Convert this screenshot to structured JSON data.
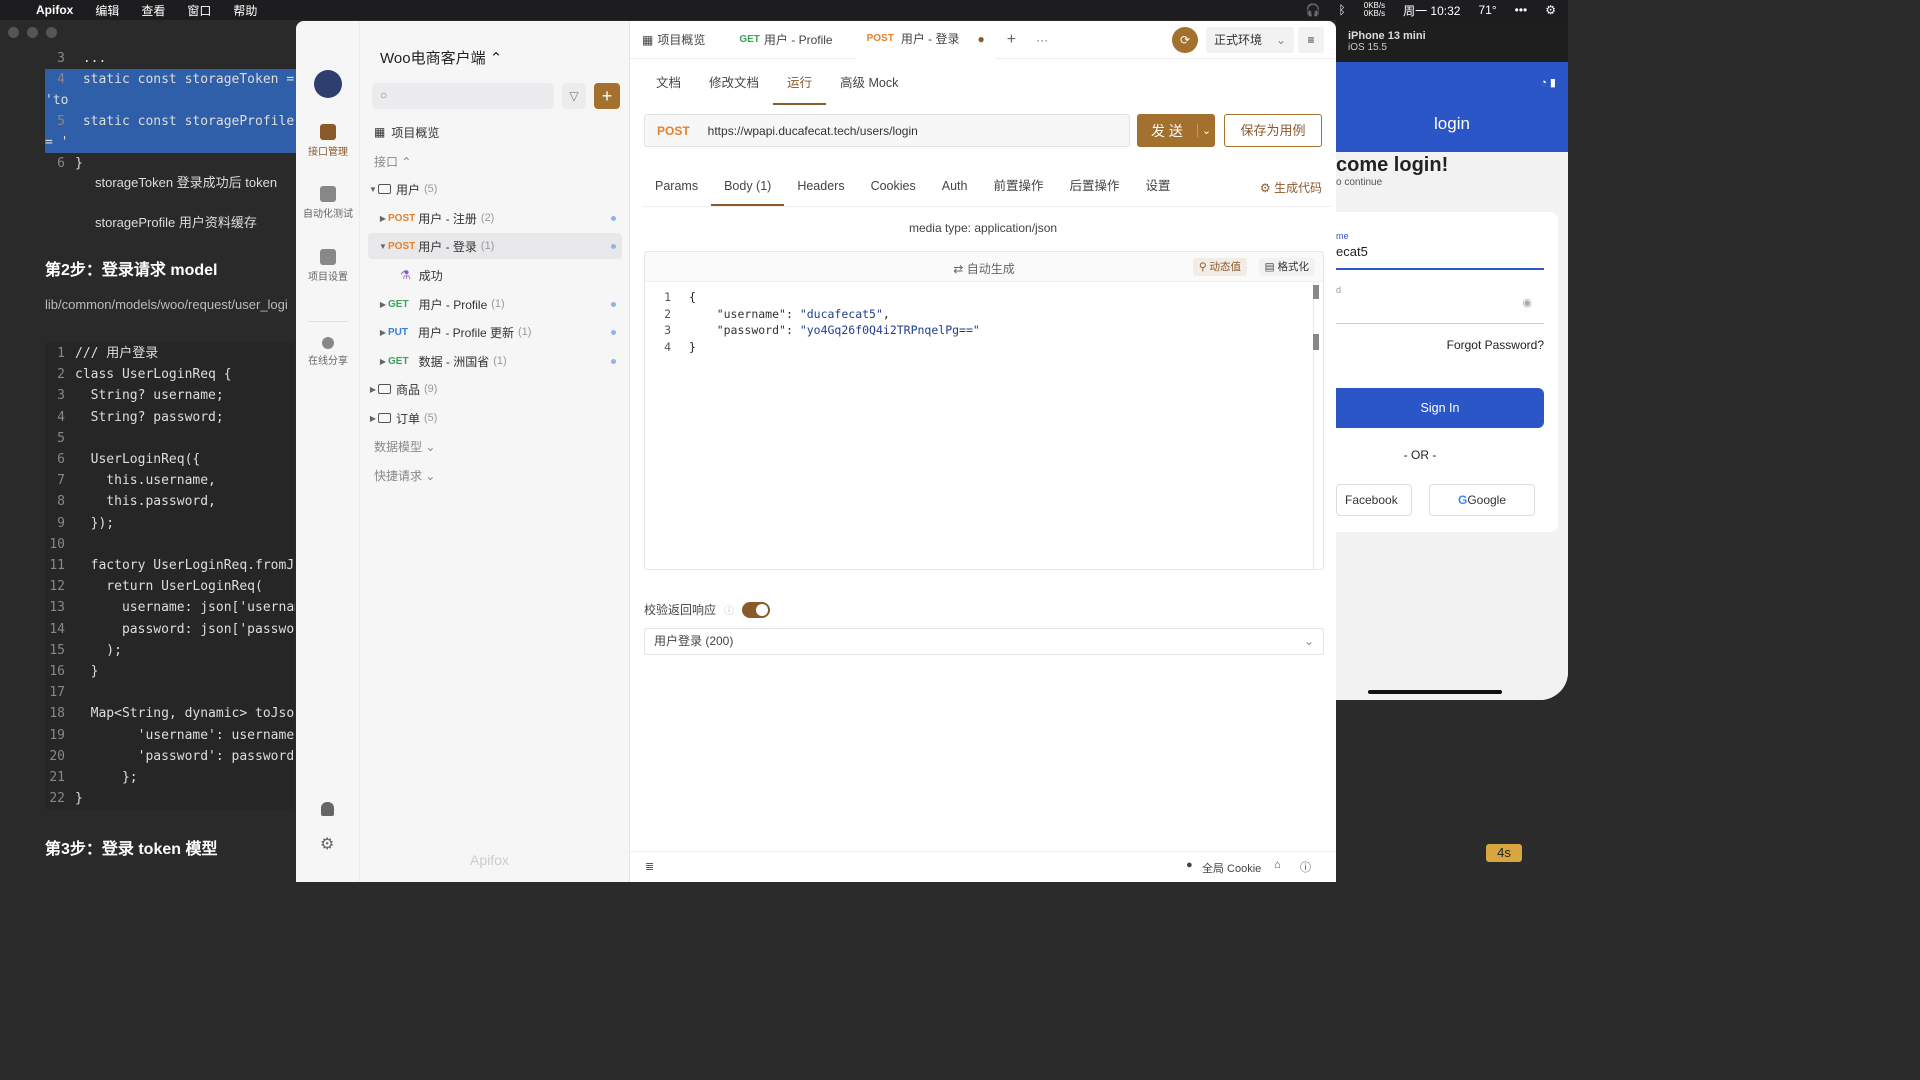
{
  "menubar": {
    "app": "Apifox",
    "items": [
      "编辑",
      "查看",
      "窗口",
      "帮助"
    ],
    "clock": "周一 10:32",
    "temp": "71°",
    "net_up": "0KB/s",
    "net_down": "0KB/s"
  },
  "bg_doc": {
    "code_top": [
      {
        "n": "3",
        "t": "  ..."
      },
      {
        "n": "4",
        "t": "  static const storageToken = 'to"
      },
      {
        "n": "5",
        "t": "  static const storageProfile = '"
      },
      {
        "n": "6",
        "t": "}"
      }
    ],
    "note1": "storageToken 登录成功后 token",
    "note2": "storageProfile 用户资料缓存",
    "step2": "第2步：登录请求 model",
    "path": "lib/common/models/woo/request/user_logi",
    "code": [
      {
        "n": "1",
        "t": "/// 用户登录"
      },
      {
        "n": "2",
        "t": "class UserLoginReq {"
      },
      {
        "n": "3",
        "t": "  String? username;"
      },
      {
        "n": "4",
        "t": "  String? password;"
      },
      {
        "n": "5",
        "t": ""
      },
      {
        "n": "6",
        "t": "  UserLoginReq({"
      },
      {
        "n": "7",
        "t": "    this.username,"
      },
      {
        "n": "8",
        "t": "    this.password,"
      },
      {
        "n": "9",
        "t": "  });"
      },
      {
        "n": "10",
        "t": ""
      },
      {
        "n": "11",
        "t": "  factory UserLoginReq.fromJson("
      },
      {
        "n": "12",
        "t": "    return UserLoginReq("
      },
      {
        "n": "13",
        "t": "      username: json['username']"
      },
      {
        "n": "14",
        "t": "      password: json['password']"
      },
      {
        "n": "15",
        "t": "    );"
      },
      {
        "n": "16",
        "t": "  }"
      },
      {
        "n": "17",
        "t": ""
      },
      {
        "n": "18",
        "t": "  Map<String, dynamic> toJson()"
      },
      {
        "n": "19",
        "t": "        'username': username,"
      },
      {
        "n": "20",
        "t": "        'password': password,"
      },
      {
        "n": "21",
        "t": "      };"
      },
      {
        "n": "22",
        "t": "}"
      }
    ],
    "step3": "第3步：登录 token 模型"
  },
  "phone": {
    "device": "iPhone 13 mini",
    "os": "iOS 15.5",
    "appbar_title": "login",
    "welcome": "come login!",
    "subtitle": "o continue",
    "username_label": "me",
    "username_value": "ecat5",
    "password_label": "d",
    "forgot": "Forgot Password?",
    "signin": "Sign In",
    "or": "- OR -",
    "facebook": "Facebook",
    "google": "Google",
    "timer": "4s"
  },
  "sidebar": {
    "items": [
      {
        "label": "接口管理",
        "icon": "api-icon"
      },
      {
        "label": "自动化测试",
        "icon": "test-icon"
      },
      {
        "label": "项目设置",
        "icon": "settings-icon"
      },
      {
        "label": "在线分享",
        "icon": "share-icon"
      }
    ]
  },
  "tree": {
    "project": "Woo电商客户端 ⌃",
    "overview": "项目概览",
    "api_section": "接口 ⌃",
    "user_folder": "用户",
    "user_count": "(5)",
    "apis": [
      {
        "method": "POST",
        "name": "用户 - 注册",
        "count": "(2)"
      },
      {
        "method": "POST",
        "name": "用户 - 登录",
        "count": "(1)"
      },
      {
        "method": "GET",
        "name": "用户 - Profile",
        "count": "(1)"
      },
      {
        "method": "PUT",
        "name": "用户 - Profile 更新",
        "count": "(1)"
      },
      {
        "method": "GET",
        "name": "数据 - 洲国省",
        "count": "(1)"
      }
    ],
    "case": "成功",
    "goods": "商品",
    "goods_count": "(9)",
    "orders": "订单",
    "orders_count": "(5)",
    "models": "数据模型 ⌄",
    "quick": "快捷请求 ⌄",
    "watermark": "Apifox"
  },
  "tabs": [
    {
      "method": "",
      "label": "项目概览"
    },
    {
      "method": "GET",
      "label": "用户 - Profile"
    },
    {
      "method": "POST",
      "label": "用户 - 登录"
    }
  ],
  "env": "正式环境",
  "subtabs": [
    "文档",
    "修改文档",
    "运行",
    "高级 Mock"
  ],
  "request": {
    "method": "POST",
    "url": "https://wpapi.ducafecat.tech/users/login",
    "send": "发 送",
    "save": "保存为用例"
  },
  "reqtabs": [
    "Params",
    "Body (1)",
    "Headers",
    "Cookies",
    "Auth",
    "前置操作",
    "后置操作",
    "设置"
  ],
  "gencode": "生成代码",
  "media_type": "media type: application/json",
  "editor": {
    "auto_gen": "自动生成",
    "dynamic": "动态值",
    "format": "格式化",
    "lines": [
      {
        "n": "1",
        "pre": "{",
        "k": "",
        "mid": "",
        "v": "",
        "post": ""
      },
      {
        "n": "2",
        "pre": "    ",
        "k": "\"username\"",
        "mid": ": ",
        "v": "\"ducafecat5\"",
        "post": ","
      },
      {
        "n": "3",
        "pre": "    ",
        "k": "\"password\"",
        "mid": ": ",
        "v": "\"yo4Gq26f0Q4i2TRPnqelPg==\"",
        "post": ""
      },
      {
        "n": "4",
        "pre": "}",
        "k": "",
        "mid": "",
        "v": "",
        "post": ""
      }
    ]
  },
  "verify_label": "校验返回响应",
  "response_select": "用户登录 (200)",
  "footer": {
    "cookie": "全局 Cookie"
  },
  "colors": {
    "accent": "#8b5a2b",
    "post": "#e5802f",
    "get": "#3aa35a",
    "put": "#3a7ed8"
  }
}
